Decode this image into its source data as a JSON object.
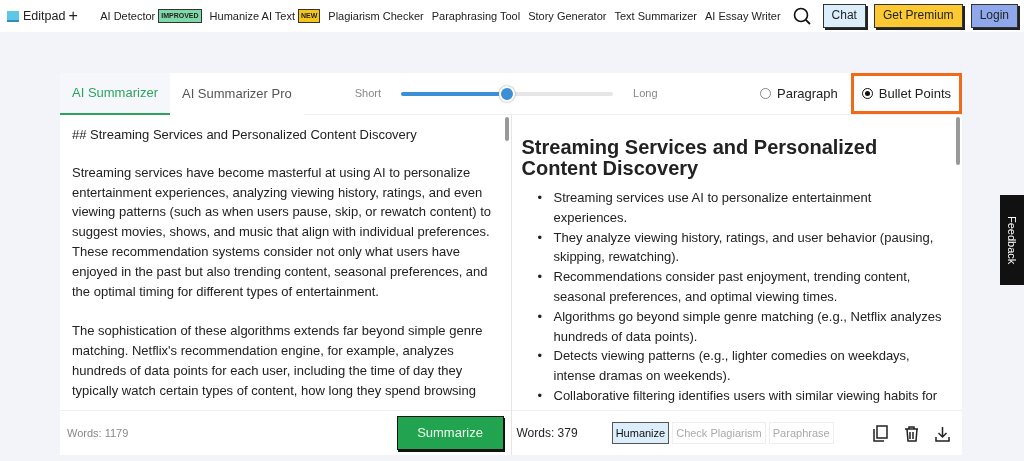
{
  "header": {
    "brand": "Editpad",
    "add_label": "+",
    "nav": [
      {
        "label": "AI Detector",
        "badge": {
          "text": "IMPROVED",
          "color": "#7fd8a8"
        }
      },
      {
        "label": "Humanize AI Text",
        "badge": {
          "text": "NEW",
          "color": "#f5c518"
        }
      },
      {
        "label": "Plagiarism Checker"
      },
      {
        "label": "Paraphrasing Tool"
      },
      {
        "label": "Story Generator"
      },
      {
        "label": "Text Summarizer"
      },
      {
        "label": "AI Essay Writer"
      }
    ],
    "buttons": [
      {
        "label": "Chat",
        "kind": "chat"
      },
      {
        "label": "Get Premium",
        "kind": "premium"
      },
      {
        "label": "Login",
        "kind": "login"
      }
    ]
  },
  "tabs": [
    {
      "label": "AI Summarizer",
      "selected": true
    },
    {
      "label": "AI Summarizer Pro",
      "selected": false
    }
  ],
  "length_slider": {
    "min_label": "Short",
    "max_label": "Long",
    "level": 0.5
  },
  "modes": [
    {
      "label": "Paragraph",
      "selected": false,
      "highlighted": false
    },
    {
      "label": "Bullet Points",
      "selected": true,
      "highlighted": true
    }
  ],
  "input": {
    "paragraphs": [
      "## Streaming Services and Personalized Content Discovery",
      "Streaming services have become masterful at using AI to personalize entertainment experiences, analyzing viewing history, ratings, and even viewing patterns (such as when users pause, skip, or rewatch content) to suggest movies, shows, and music that align with individual preferences. These recommendation systems consider not only what users have enjoyed in the past but also trending content, seasonal preferences, and the optimal timing for different types of entertainment.",
      "The sophistication of these algorithms extends far beyond simple genre matching. Netflix's recommendation engine, for example, analyzes hundreds of data points for each user, including the time of day they typically watch certain types of content, how long they spend browsing"
    ],
    "word_count": "Words: 1179",
    "action": "Summarize"
  },
  "output": {
    "bullet_marker": "•",
    "heading": "Streaming Services and Personalized Content Discovery",
    "bullets": [
      "Streaming services use AI to personalize entertainment experiences.",
      "They analyze viewing history, ratings, and user behavior (pausing, skipping, rewatching).",
      "Recommendations consider past enjoyment, trending content, seasonal preferences, and optimal viewing times.",
      "Algorithms go beyond simple genre matching (e.g., Netflix analyzes hundreds of data points).",
      "Detects viewing patterns (e.g., lighter comedies on weekdays, intense dramas on weekends).",
      "Collaborative filtering identifies users with similar viewing habits for"
    ],
    "word_count": "Words: 379",
    "actions": [
      {
        "label": "Humanize",
        "selected": true
      },
      {
        "label": "Check Plagiarism",
        "selected": false
      },
      {
        "label": "Paraphrase",
        "selected": false
      }
    ]
  },
  "feedback": "Feedback"
}
